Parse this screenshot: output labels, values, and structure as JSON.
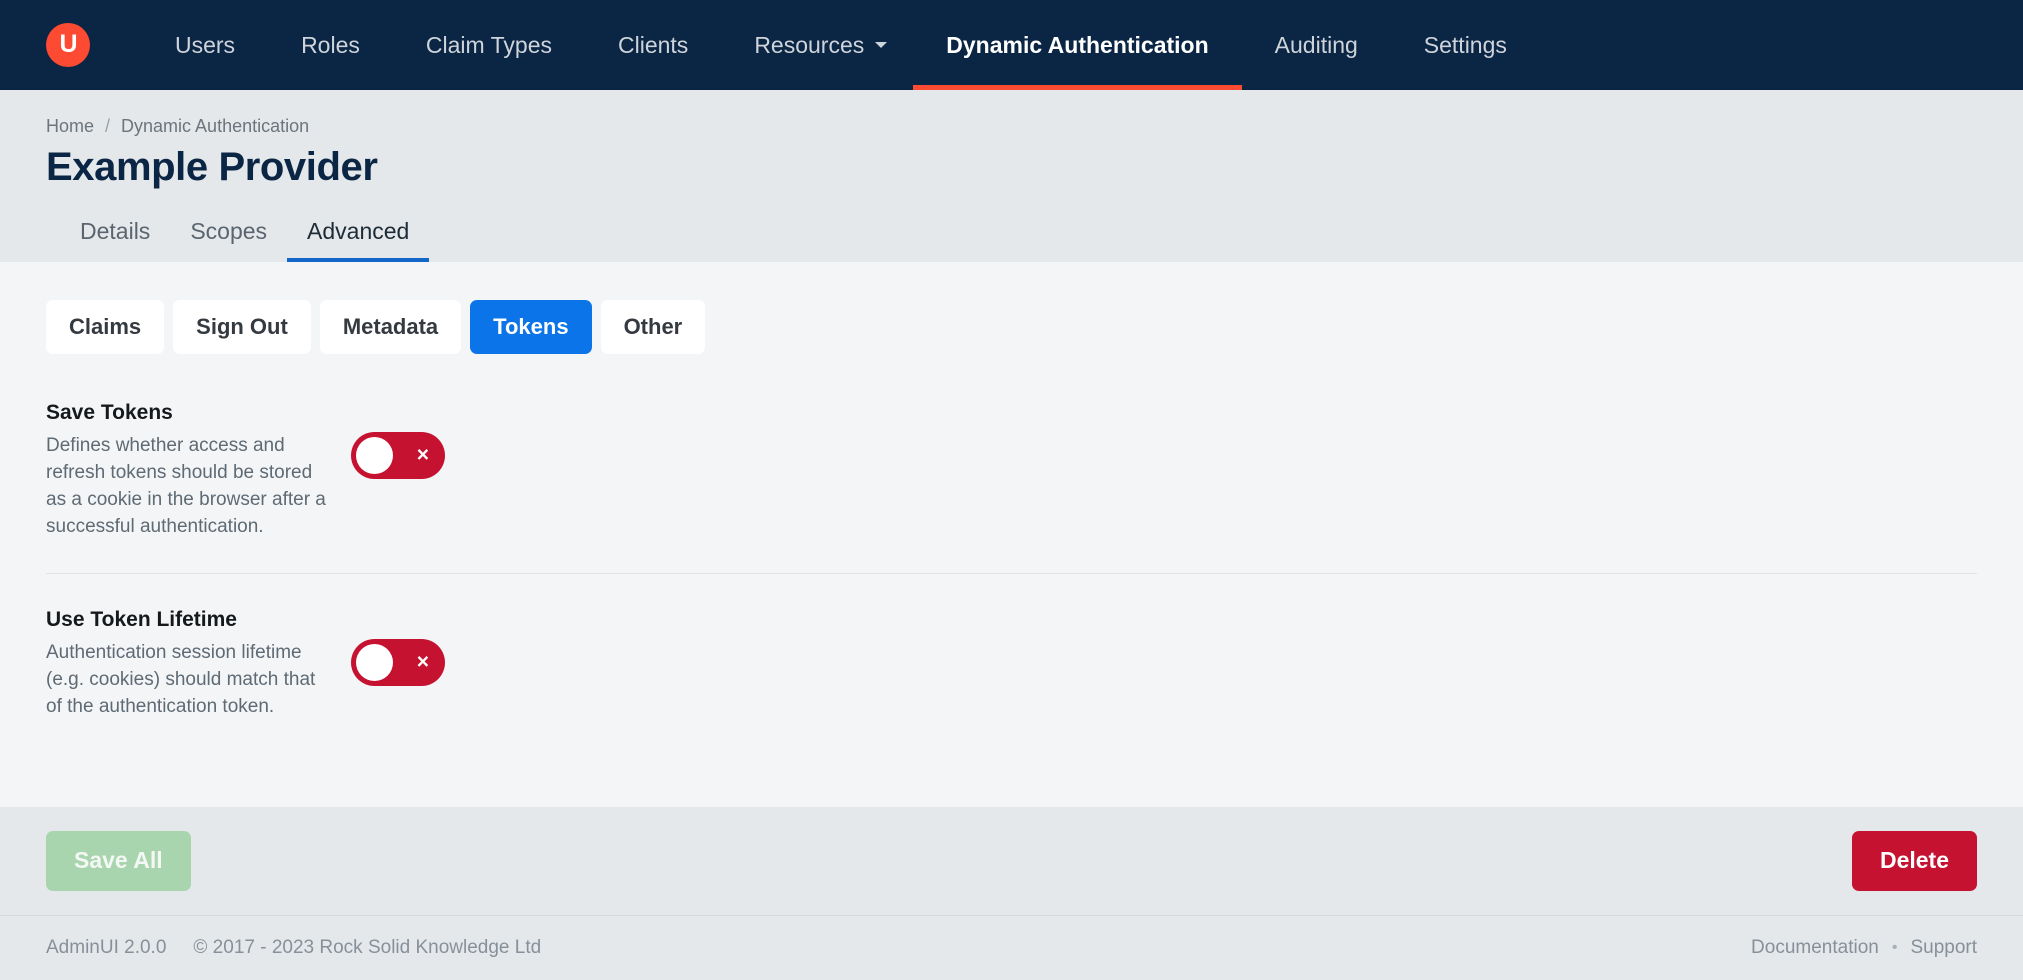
{
  "colors": {
    "nav_bg": "#0b2544",
    "brand_orange": "#fc4a33",
    "accent_blue": "#0a74e8",
    "tab_underline_blue": "#1266c7",
    "danger_red": "#c41230",
    "save_green_disabled": "#a8d5ae",
    "header_bg": "#e4e8ea",
    "content_bg": "#f4f5f7"
  },
  "topnav": {
    "brand": {
      "logo_text": "U",
      "icon": "ui-circle-logo-icon"
    },
    "items": [
      {
        "label": "Users",
        "active": false,
        "caret": false
      },
      {
        "label": "Roles",
        "active": false,
        "caret": false
      },
      {
        "label": "Claim Types",
        "active": false,
        "caret": false
      },
      {
        "label": "Clients",
        "active": false,
        "caret": false
      },
      {
        "label": "Resources",
        "active": false,
        "caret": true
      },
      {
        "label": "Dynamic Authentication",
        "active": true,
        "caret": false
      },
      {
        "label": "Auditing",
        "active": false,
        "caret": false
      },
      {
        "label": "Settings",
        "active": false,
        "caret": false
      }
    ]
  },
  "page_header": {
    "breadcrumb": [
      {
        "label": "Home",
        "link": true
      },
      {
        "label": "Dynamic Authentication",
        "link": false
      }
    ],
    "breadcrumb_separator": "/",
    "title": "Example Provider",
    "tabs": [
      {
        "label": "Details",
        "active": false
      },
      {
        "label": "Scopes",
        "active": false
      },
      {
        "label": "Advanced",
        "active": true
      }
    ]
  },
  "main": {
    "section_pills": [
      {
        "label": "Claims",
        "active": false
      },
      {
        "label": "Sign Out",
        "active": false
      },
      {
        "label": "Metadata",
        "active": false
      },
      {
        "label": "Tokens",
        "active": true
      },
      {
        "label": "Other",
        "active": false
      }
    ],
    "settings": [
      {
        "title": "Save Tokens",
        "description": "Defines whether access and refresh tokens should be stored as a cookie in the browser after a successful authentication.",
        "toggle": {
          "state": "off",
          "mark": "×",
          "icon": "toggle-switch-off-icon"
        }
      },
      {
        "title": "Use Token Lifetime",
        "description": "Authentication session lifetime (e.g. cookies) should match that of the authentication token.",
        "toggle": {
          "state": "off",
          "mark": "×",
          "icon": "toggle-switch-off-icon"
        }
      }
    ]
  },
  "actionbar": {
    "save_label": "Save All",
    "save_disabled": true,
    "delete_label": "Delete"
  },
  "footer": {
    "version": "AdminUI 2.0.0",
    "copyright": "© 2017 - 2023 Rock Solid Knowledge Ltd",
    "documentation_label": "Documentation",
    "separator": "•",
    "support_label": "Support"
  }
}
